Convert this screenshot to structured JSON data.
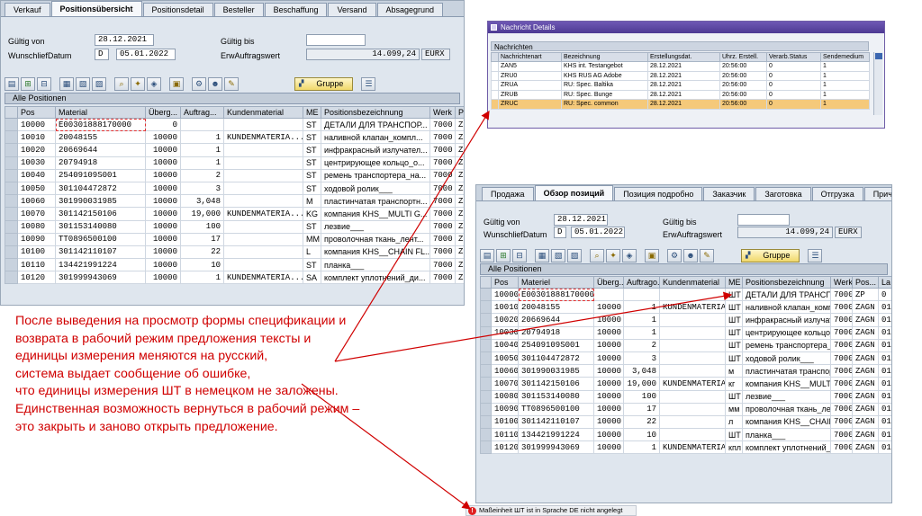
{
  "note": {
    "lines": [
      "После выведения на просмотр формы спецификации и",
      "возврата в рабочий режим предложения тексты и",
      "единицы измерения меняются на русский,",
      "система выдает сообщение об ошибке,",
      "что единицы измерения ШТ в немецком не заложены.",
      "Единственная возможность вернуться в рабочий режим –",
      "это закрыть и заново открыть предложение."
    ]
  },
  "left_panel": {
    "tabs": [
      "Verkauf",
      "Positionsübersicht",
      "Positionsdetail",
      "Besteller",
      "Beschaffung",
      "Versand",
      "Absagegrund"
    ],
    "fields": {
      "gueltig_von_label": "Gültig von",
      "gueltig_von_value": "28.12.2021",
      "gueltig_bis_label": "Gültig bis",
      "gueltig_bis_value": "",
      "wunschlief_label": "WunschliefDatum",
      "wunschlief_prefix": "D",
      "wunschlief_value": "05.01.2022",
      "erw_label": "ErwAuftragswert",
      "erw_value": "14.099,24",
      "erw_currency": "EURX"
    },
    "gruppe_label": "Gruppe",
    "section_title": "Alle Positionen",
    "columns": [
      "Pos",
      "Material",
      "Überg...",
      "Auftrag...",
      "Kundenmaterial",
      "ME",
      "Positionsbezeichnung",
      "Werk",
      "P"
    ],
    "rows": [
      [
        "10000",
        "E00301888170000",
        "0",
        "",
        "",
        "ST",
        "ДЕТАЛИ ДЛЯ ТРАНСПОР...",
        "7000",
        "Z"
      ],
      [
        "10010",
        "20048155",
        "10000",
        "1",
        "KUNDENMATERIA...",
        "ST",
        "наливной клапан_компл...",
        "7000",
        "Z"
      ],
      [
        "10020",
        "20669644",
        "10000",
        "1",
        "",
        "ST",
        "инфракрасный излучател...",
        "7000",
        "Z"
      ],
      [
        "10030",
        "20794918",
        "10000",
        "1",
        "",
        "ST",
        "центрирующее кольцо_о...",
        "7000",
        "Z"
      ],
      [
        "10040",
        "25409109S001",
        "10000",
        "2",
        "",
        "ST",
        "ремень транспортера_на...",
        "7000",
        "Z"
      ],
      [
        "10050",
        "301104472872",
        "10000",
        "3",
        "",
        "ST",
        "ходовой ролик___",
        "7000",
        "Z"
      ],
      [
        "10060",
        "301990031985",
        "10000",
        "3,048",
        "",
        "M",
        "пластинчатая транспортн...",
        "7000",
        "Z"
      ],
      [
        "10070",
        "301142150106",
        "10000",
        "19,000",
        "KUNDENMATERIA...",
        "KG",
        "компания KHS__MULTI G...",
        "7000",
        "Z"
      ],
      [
        "10080",
        "301153140080",
        "10000",
        "100",
        "",
        "ST",
        "лезвие___",
        "7000",
        "Z"
      ],
      [
        "10090",
        "TT0896500100",
        "10000",
        "17",
        "",
        "MM",
        "проволочная ткань_лент...",
        "7000",
        "Z"
      ],
      [
        "10100",
        "301142110107",
        "10000",
        "22",
        "",
        "L",
        "компания KHS__CHAIN FL...",
        "7000",
        "Z"
      ],
      [
        "10110",
        "134421991224",
        "10000",
        "10",
        "",
        "ST",
        "планка___",
        "7000",
        "Z"
      ],
      [
        "10120",
        "301999943069",
        "10000",
        "1",
        "KUNDENMATERIA...",
        "SA",
        "комплект уплотнений_ди...",
        "7000",
        "Z"
      ]
    ]
  },
  "right_panel": {
    "tabs": [
      "Продажа",
      "Обзор позиций",
      "Позиция подробно",
      "Заказчик",
      "Заготовка",
      "Отгрузка",
      "Причина отклонения"
    ],
    "fields": {
      "gueltig_von_label": "Gültig von",
      "gueltig_von_value": "28.12.2021",
      "gueltig_bis_label": "Gültig bis",
      "gueltig_bis_value": "",
      "wunschlief_label": "WunschliefDatum",
      "wunschlief_prefix": "D",
      "wunschlief_value": "05.01.2022",
      "erw_label": "ErwAuftragswert",
      "erw_value": "14.099,24",
      "erw_currency": "EURX"
    },
    "gruppe_label": "Gruppe",
    "section_title": "Alle Positionen",
    "columns": [
      "Pos",
      "Materiel",
      "Überg...",
      "Auftrago...",
      "Kundenmaterial",
      "ME",
      "Positionsbezeichnung",
      "Werk",
      "Pos...",
      "La"
    ],
    "rows": [
      [
        "10000",
        "E00301888170000",
        "",
        "",
        "",
        "ШТ",
        "ДЕТАЛИ ДЛЯ ТРАНСПОР...",
        "7000",
        "ZP",
        "0"
      ],
      [
        "10010",
        "20048155",
        "10000",
        "1",
        "KUNDENMATERIA...",
        "ШТ",
        "наливной клапан_компл...",
        "7000",
        "ZAGN",
        "01"
      ],
      [
        "10020",
        "20669644",
        "10000",
        "1",
        "",
        "ШТ",
        "инфракрасный излучател...",
        "7000",
        "ZAGN",
        "01"
      ],
      [
        "10030",
        "20794918",
        "10000",
        "1",
        "",
        "ШТ",
        "центрирующее кольцо_о...",
        "7000",
        "ZAGN",
        "01"
      ],
      [
        "10040",
        "25409109S001",
        "10000",
        "2",
        "",
        "ШТ",
        "ремень транспортера_на...",
        "7000",
        "ZAGN",
        "01"
      ],
      [
        "10050",
        "301104472872",
        "10000",
        "3",
        "",
        "ШТ",
        "ходовой ролик___",
        "7000",
        "ZAGN",
        "01"
      ],
      [
        "10060",
        "301990031985",
        "10000",
        "3,048",
        "",
        "м",
        "пластинчатая транспортн...",
        "7000",
        "ZAGN",
        "01"
      ],
      [
        "10070",
        "301142150106",
        "10000",
        "19,000",
        "KUNDENMATERIA...",
        "кг",
        "компания KHS__MULTI G...",
        "7000",
        "ZAGN",
        "01"
      ],
      [
        "10080",
        "301153140080",
        "10000",
        "100",
        "",
        "ШТ",
        "лезвие___",
        "7000",
        "ZAGN",
        "01"
      ],
      [
        "10090",
        "TT0896500100",
        "10000",
        "17",
        "",
        "мм",
        "проволочная ткань_лент...",
        "7000",
        "ZAGN",
        "01"
      ],
      [
        "10100",
        "301142110107",
        "10000",
        "22",
        "",
        "л",
        "компания KHS__CHAIN FL...",
        "7000",
        "ZAGN",
        "01"
      ],
      [
        "10110",
        "134421991224",
        "10000",
        "10",
        "",
        "ШТ",
        "планка___",
        "7000",
        "ZAGN",
        "01"
      ],
      [
        "10120",
        "301999943069",
        "10000",
        "1",
        "KUNDENMATERIA...",
        "кпл",
        "комплект уплотнений_ди...",
        "7000",
        "ZAGN",
        "01"
      ]
    ]
  },
  "messages": {
    "title": "Nachricht Details",
    "section": "Nachrichten",
    "columns": [
      "Nachrichtenart",
      "Bezeichnung",
      "Erstellungsdat.",
      "Uhrz. Erstell.",
      "Verarb.Status",
      "Sendemedium"
    ],
    "rows": [
      [
        "ZAN5",
        "KHS int. Testangebot",
        "28.12.2021",
        "20:56:00",
        "0",
        "1"
      ],
      [
        "ZRU0",
        "KHS RUS AG Adobe",
        "28.12.2021",
        "20:56:00",
        "0",
        "1"
      ],
      [
        "ZRUA",
        "RU: Spec. Baltika",
        "28.12.2021",
        "20:56:00",
        "0",
        "1"
      ],
      [
        "ZRUB",
        "RU: Spec. Bunge",
        "28.12.2021",
        "20:56:00",
        "0",
        "1"
      ],
      [
        "ZRUC",
        "RU: Spec. common",
        "28.12.2021",
        "20:56:00",
        "0",
        "1"
      ]
    ]
  },
  "status_bar": {
    "message": "Maßeinheit ШТ ist in Sprache DE nicht angelegt",
    "type": "error"
  },
  "colors": {
    "annotation": "#d00000",
    "highlight_row": "#f5c97a"
  }
}
